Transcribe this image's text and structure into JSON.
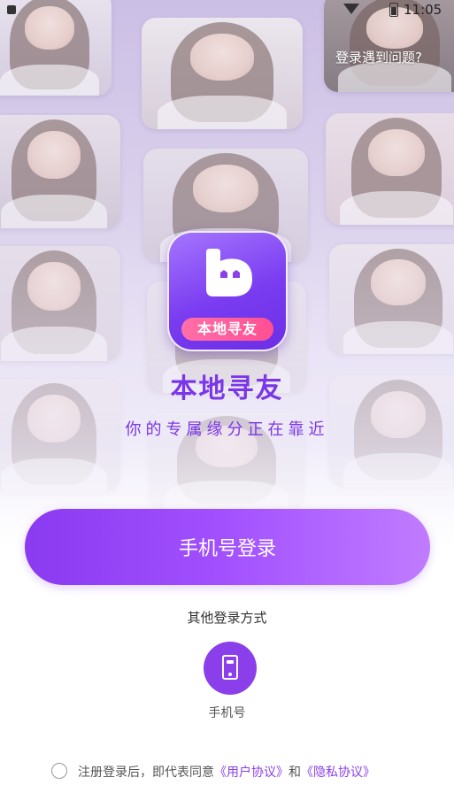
{
  "status_bar": {
    "time": "11:05"
  },
  "header": {
    "help_link": "登录遇到问题?"
  },
  "brand": {
    "logo_badge": "本地寻友",
    "app_name": "本地寻友",
    "tagline": "你的专属缘分正在靠近",
    "accent_color": "#7a36e8"
  },
  "login": {
    "phone_login_button": "手机号登录",
    "other_methods_label": "其他登录方式",
    "methods": [
      {
        "icon": "phone-icon",
        "label": "手机号"
      }
    ]
  },
  "agreement": {
    "prefix": "注册登录后，即代表同意",
    "user_agreement": "《用户协议》",
    "conjunction": "和",
    "privacy_policy": "《隐私协议》",
    "checked": false
  }
}
